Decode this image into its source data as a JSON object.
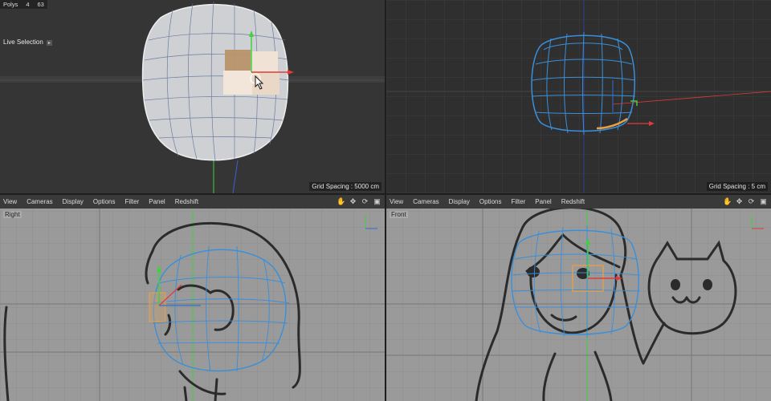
{
  "top_left": {
    "stats": {
      "label": "Polys",
      "value1": "4",
      "value2": "63"
    },
    "tool_label": "Live Selection",
    "grid_spacing": "Grid Spacing : 5000 cm"
  },
  "top_right": {
    "grid_spacing": "Grid Spacing : 5 cm"
  },
  "bottom_left": {
    "menu": [
      "View",
      "Cameras",
      "Display",
      "Options",
      "Filter",
      "Panel",
      "Redshift"
    ],
    "label": "Right"
  },
  "bottom_right": {
    "menu": [
      "View",
      "Cameras",
      "Display",
      "Options",
      "Filter",
      "Panel",
      "Redshift"
    ],
    "label": "Front"
  },
  "nav_icons": [
    "hand-pan-icon",
    "move-arrows-icon",
    "rotate-icon",
    "maximize-icon"
  ],
  "colors": {
    "wire_blue": "#3a8fd9",
    "selection_orange": "#e8a048",
    "axis_red": "#e03b3b",
    "axis_green": "#3fd23f",
    "sketch_line": "#2b2b2b"
  }
}
